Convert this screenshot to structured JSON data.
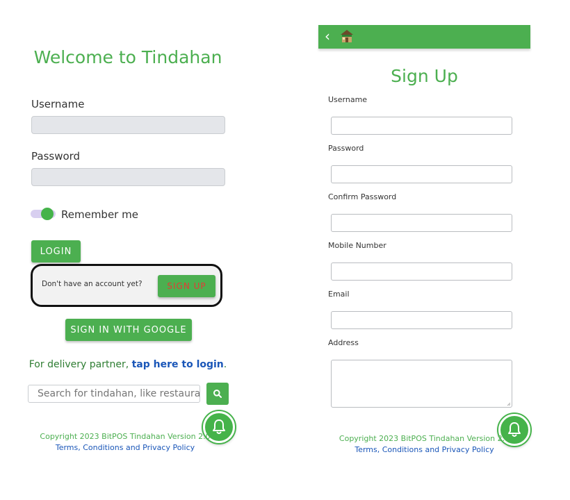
{
  "login": {
    "title": "Welcome to Tindahan",
    "username_label": "Username",
    "password_label": "Password",
    "remember_label": "Remember me",
    "login_button": "LOGIN",
    "no_account_text": "Don't have an account yet?",
    "signup_button": "SIGN UP",
    "google_button": "SIGN IN WITH GOOGLE",
    "delivery_prefix": "For delivery partner, ",
    "delivery_link": "tap here to login",
    "delivery_suffix": ".",
    "search_placeholder": "Search for tindahan, like restauran",
    "copyright": "Copyright 2023 BitPOS Tindahan Version 2.0",
    "terms": "Terms, Conditions and Privacy Policy"
  },
  "signup": {
    "back_glyph": "‹",
    "title": "Sign Up",
    "fields": {
      "username": "Username",
      "password": "Password",
      "confirm_password": "Confirm Password",
      "mobile": "Mobile Number",
      "email": "Email",
      "address": "Address"
    },
    "copyright": "Copyright 2023 BitPOS Tindahan Version 2.0",
    "terms": "Terms, Conditions and Privacy Policy"
  },
  "colors": {
    "brand_green": "#4caf50",
    "signup_text_red": "#e53935",
    "link_blue": "#1a56b8",
    "highlight_outline": "#111111"
  },
  "icons": {
    "search": "search-icon",
    "bell": "bell-icon",
    "back": "chevron-left-icon",
    "store": "store-logo-icon"
  }
}
